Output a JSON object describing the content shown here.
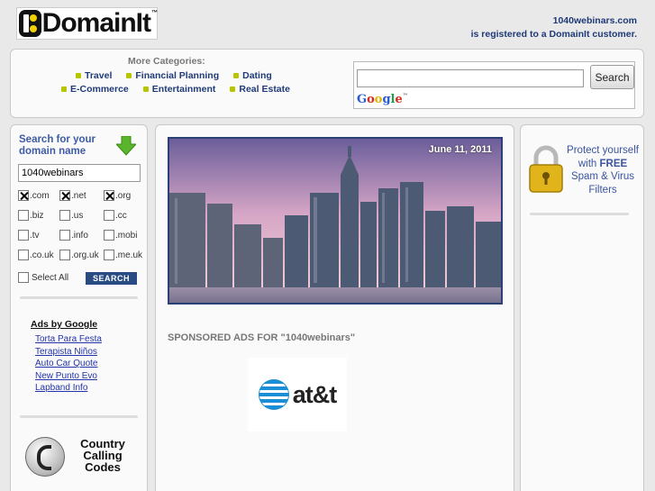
{
  "header": {
    "logo_word": "DomainIt",
    "logo_tm": "™",
    "domain": "1040webinars.com",
    "registered_text": "is registered to a DomainIt customer."
  },
  "categories": {
    "title": "More Categories:",
    "row1": [
      "Travel",
      "Financial Planning",
      "Dating"
    ],
    "row2": [
      "E-Commerce",
      "Entertainment",
      "Real Estate"
    ]
  },
  "google_search": {
    "value": "",
    "button_label": "Search",
    "brand": "Google",
    "brand_tm": "™"
  },
  "domain_search": {
    "title": "Search for your domain name",
    "input_value": "1040webinars",
    "tlds": [
      {
        "label": ".com",
        "checked": true
      },
      {
        "label": ".net",
        "checked": true
      },
      {
        "label": ".org",
        "checked": true
      },
      {
        "label": ".biz",
        "checked": false
      },
      {
        "label": ".us",
        "checked": false
      },
      {
        "label": ".cc",
        "checked": false
      },
      {
        "label": ".tv",
        "checked": false
      },
      {
        "label": ".info",
        "checked": false
      },
      {
        "label": ".mobi",
        "checked": false
      },
      {
        "label": ".co.uk",
        "checked": false
      },
      {
        "label": ".org.uk",
        "checked": false
      },
      {
        "label": ".me.uk",
        "checked": false
      }
    ],
    "select_all_label": "Select All",
    "search_button": "SEARCH"
  },
  "ads": {
    "title": "Ads by Google",
    "links": [
      "Torta Para Festa",
      "Terapista Niños",
      "Auto Car Quote",
      "New Punto Evo",
      "Lapband Info"
    ]
  },
  "country_codes": {
    "line1": "Country",
    "line2": "Calling",
    "line3": "Codes"
  },
  "main": {
    "date": "June 11, 2011",
    "sponsored_title": "SPONSORED ADS FOR \"1040webinars\"",
    "sponsor_logo_text": "at&t"
  },
  "promo": {
    "line1": "Protect yourself",
    "line2_pre": "with ",
    "line2_bold": "FREE",
    "line3": "Spam & Virus",
    "line4": "Filters"
  },
  "colors": {
    "background": "#e9e9e9",
    "link_blue": "#1f3a78",
    "ad_link": "#2333a8",
    "search_button": "#2a4a84",
    "category_arrow": "#b7c400"
  }
}
